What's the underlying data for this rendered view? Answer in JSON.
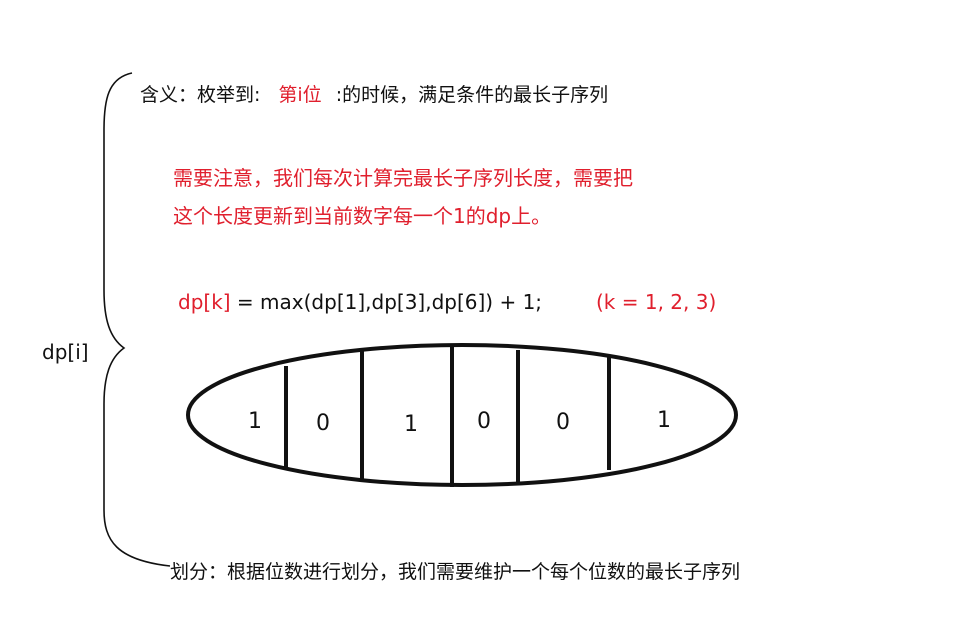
{
  "meaning": {
    "prefix": "含义：枚举到:",
    "highlight": "第i位",
    "suffix": ":的时候，满足条件的最长子序列"
  },
  "note": {
    "line1": "需要注意，我们每次计算完最长子序列长度，需要把",
    "line2": "这个长度更新到当前数字每一个1的dp上。"
  },
  "formula": {
    "lhs": "dp[k]",
    "rhs": " = max(dp[1],dp[3],dp[6]) + 1;",
    "k_values": "(k  = 1, 2, 3)"
  },
  "dp_label": "dp[i]",
  "bits": [
    "1",
    "0",
    "1",
    "0",
    "0",
    "1"
  ],
  "division": "划分：根据位数进行划分，我们需要维护一个每个位数的最长子序列",
  "colors": {
    "red": "#e01f2d",
    "black": "#111111"
  }
}
